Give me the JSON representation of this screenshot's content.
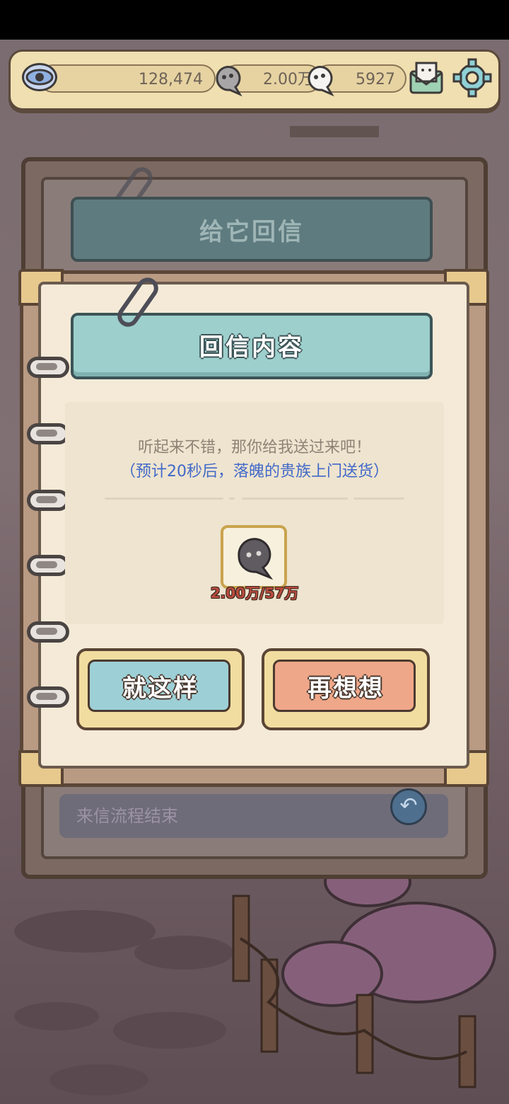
{
  "topbar": {
    "views_value": "128,474",
    "gray_ghost_value": "2.00万",
    "white_ghost_value": "5927",
    "icons": [
      "eye-icon",
      "gray-ghost-icon",
      "white-ghost-icon",
      "mail-icon",
      "gear-icon"
    ]
  },
  "back_panel": {
    "title": "给它回信",
    "footer_text": "来信流程结束"
  },
  "dialog": {
    "title": "回信内容",
    "message": "听起来不错，那你给我送过来吧！",
    "note": "（预计20秒后，落魄的贵族上门送货）",
    "item_amount": "2.00万/57万",
    "confirm_label": "就这样",
    "reconsider_label": "再想想"
  },
  "colors": {
    "accent_teal": "#9dcfcc",
    "note_blue": "#4169c9",
    "warn_red": "#b94b3d",
    "confirm_button": "#9dd0d6",
    "reconsider_button": "#efa789"
  }
}
